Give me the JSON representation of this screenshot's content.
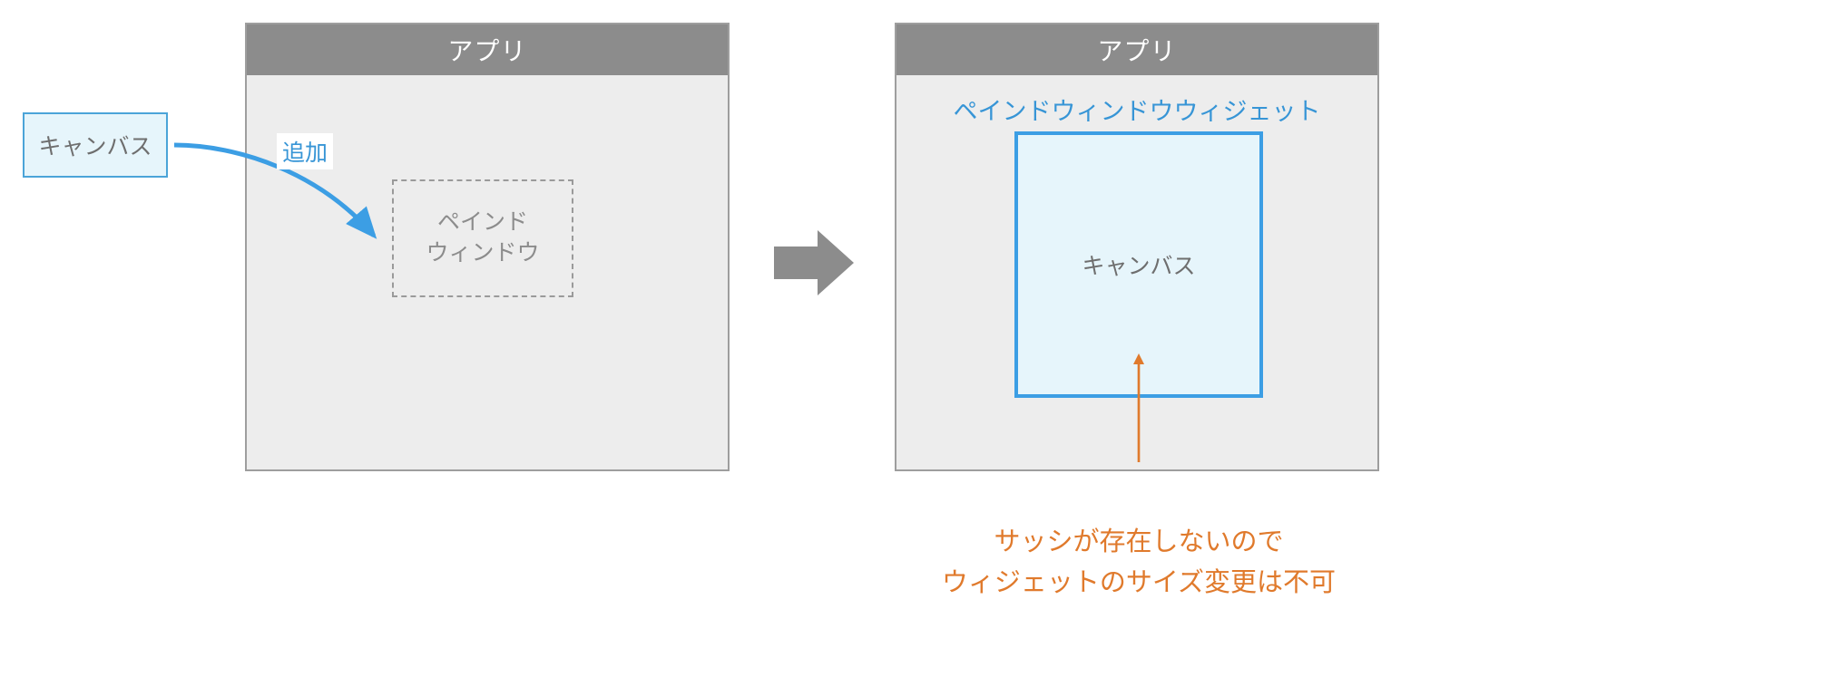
{
  "chip_label": "キャンバス",
  "app_title": "アプリ",
  "dashed": {
    "line1": "ペインド",
    "line2": "ウィンドウ"
  },
  "add_label": "追加",
  "right": {
    "paned_widget_label": "ペインドウィンドウウィジェット",
    "canvas_label": "キャンバス"
  },
  "caption": {
    "line1": "サッシが存在しないので",
    "line2": "ウィジェットのサイズ変更は不可"
  },
  "colors": {
    "blue": "#3C9EE4",
    "orange": "#E07A2C",
    "gray_header": "#8C8C8C"
  }
}
